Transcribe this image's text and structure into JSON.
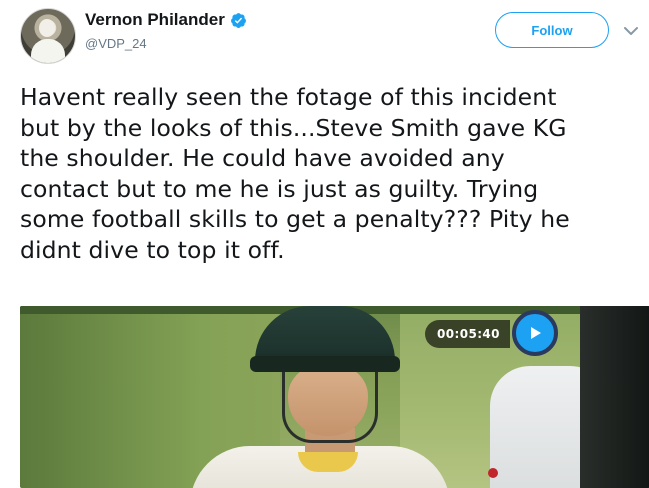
{
  "tweet": {
    "author": {
      "display_name": "Vernon Philander",
      "handle": "@VDP_24",
      "verified": true,
      "avatar_icon": "profile-photo"
    },
    "follow_label": "Follow",
    "menu_icon": "chevron-down-icon",
    "text_lines": [
      "Havent really seen the fotage of this incident",
      "but by the looks of this...Steve Smith gave KG",
      "the shoulder. He could have avoided any",
      "contact but to me he is just as guilty. Trying",
      "some football skills to get a penalty??? Pity he",
      "didnt dive to top it off."
    ],
    "media": {
      "timecode": "00:05:40",
      "play_icon": "play-icon"
    }
  },
  "colors": {
    "accent": "#1da1f2",
    "text": "#14171a",
    "muted": "#657786"
  }
}
